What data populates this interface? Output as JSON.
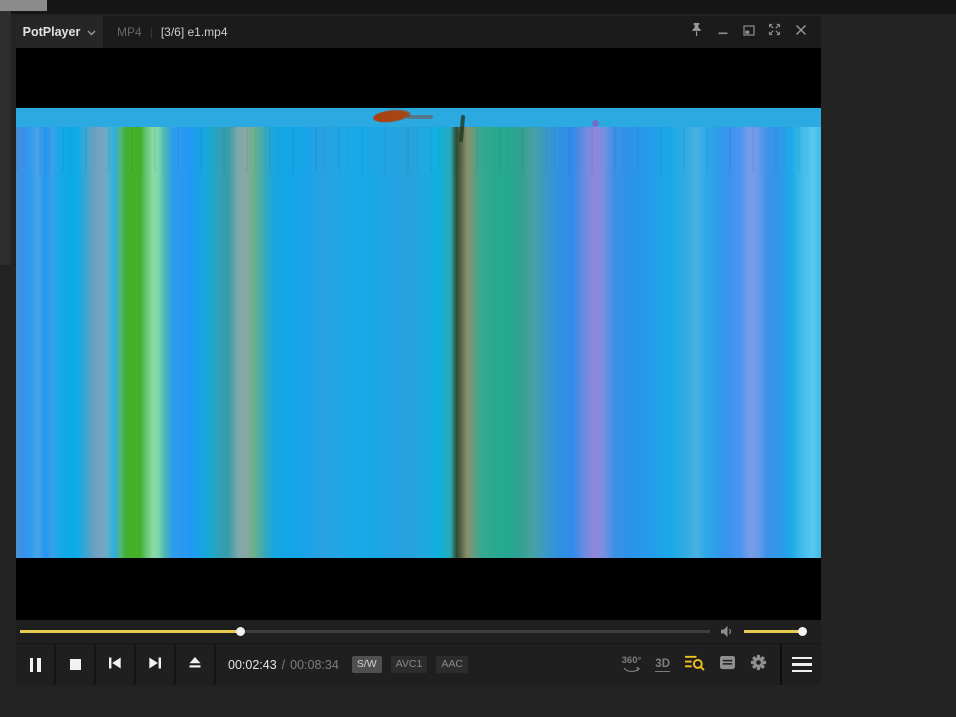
{
  "window": {
    "app_menu_label": "PotPlayer",
    "format_label": "MP4",
    "title_separator": "|",
    "file_title": "[3/6] e1.mp4"
  },
  "playback": {
    "current_time": "00:02:43",
    "time_separator": "/",
    "total_time": "00:08:34",
    "badges": [
      {
        "label": "S/W",
        "active": true
      },
      {
        "label": "AVC1",
        "active": false
      },
      {
        "label": "AAC",
        "active": false
      }
    ],
    "progress_percent": 31.9,
    "volume_percent": 94
  },
  "controls": {
    "label_360": "360°",
    "label_3d": "3D",
    "transport_icons": [
      "pause-icon",
      "stop-icon",
      "skip-previous-icon",
      "skip-next-icon",
      "eject-icon"
    ],
    "right_icons": [
      "rotation-360-icon",
      "3d-icon",
      "playlist-search-icon",
      "subtitle-doc-icon",
      "settings-gear-icon",
      "menu-hamburger-icon"
    ],
    "titlebar_icons": [
      "pin-icon",
      "minimize-icon",
      "restore-icon",
      "fullscreen-icon",
      "close-icon"
    ]
  },
  "colors": {
    "accent_yellow": "#e7cd4f",
    "icon_highlight_yellow": "#f2c41c",
    "video_top_band": "#2baae2"
  },
  "video": {
    "top_band_color": "#2baae2",
    "stripes": [
      [
        0,
        "#4796d2"
      ],
      [
        0.75,
        "#3e8ee8"
      ],
      [
        1.74,
        "#2f9bf2"
      ],
      [
        2.74,
        "#4aa4e4"
      ],
      [
        3.61,
        "#2395f2"
      ],
      [
        4.48,
        "#3aa0e8"
      ],
      [
        5.47,
        "#16a9e9"
      ],
      [
        6.72,
        "#0caae8"
      ],
      [
        7.71,
        "#12abe9"
      ],
      [
        8.96,
        "#4ba3ca"
      ],
      [
        9.83,
        "#6ba1c2"
      ],
      [
        10.7,
        "#7ba4c4"
      ],
      [
        11.44,
        "#5cb0ca"
      ],
      [
        12.31,
        "#27b1e2"
      ],
      [
        12.94,
        "#56b57a"
      ],
      [
        13.68,
        "#40ae38"
      ],
      [
        14.55,
        "#46b222"
      ],
      [
        15.42,
        "#41af2c"
      ],
      [
        16.29,
        "#6cc87e"
      ],
      [
        17.04,
        "#8cdaa2"
      ],
      [
        17.66,
        "#7ed8ac"
      ],
      [
        18.41,
        "#50b9b2"
      ],
      [
        19.4,
        "#2f9eea"
      ],
      [
        20.65,
        "#2b98f1"
      ],
      [
        21.64,
        "#2297f5"
      ],
      [
        22.64,
        "#1aa1e9"
      ],
      [
        23.88,
        "#16a9d9"
      ],
      [
        25.12,
        "#30a1b9"
      ],
      [
        26.37,
        "#389baa"
      ],
      [
        27.61,
        "#7da9aa"
      ],
      [
        28.61,
        "#8ca7a1"
      ],
      [
        29.6,
        "#69b189"
      ],
      [
        30.85,
        "#39a9b9"
      ],
      [
        32.09,
        "#16a6e1"
      ],
      [
        33.83,
        "#13a6e6"
      ],
      [
        35.95,
        "#19a3e9"
      ],
      [
        38.06,
        "#29a1e1"
      ],
      [
        40.3,
        "#21a6e6"
      ],
      [
        42.54,
        "#17a9e9"
      ],
      [
        44.78,
        "#1ca6e6"
      ],
      [
        47.01,
        "#23a3e3"
      ],
      [
        49.0,
        "#29a1d9"
      ],
      [
        50.75,
        "#1fa9e1"
      ],
      [
        52.49,
        "#10b1dd"
      ],
      [
        53.98,
        "#29a9b9"
      ],
      [
        54.73,
        "#2e4b31"
      ],
      [
        55.35,
        "#5b6949"
      ],
      [
        55.97,
        "#8b8b69"
      ],
      [
        56.72,
        "#6b9b79"
      ],
      [
        57.71,
        "#37a991"
      ],
      [
        59.2,
        "#2ba98e"
      ],
      [
        60.95,
        "#24a991"
      ],
      [
        62.56,
        "#2fa191"
      ],
      [
        64.18,
        "#49a1a1"
      ],
      [
        65.92,
        "#3999c9"
      ],
      [
        67.66,
        "#2f91e1"
      ],
      [
        69.15,
        "#308be9"
      ],
      [
        70.65,
        "#6b8be1"
      ],
      [
        71.77,
        "#9087d9"
      ],
      [
        72.89,
        "#7b8fe1"
      ],
      [
        74.38,
        "#3b91e6"
      ],
      [
        76.12,
        "#2b93e9"
      ],
      [
        77.86,
        "#2997eb"
      ],
      [
        79.6,
        "#20a1e9"
      ],
      [
        81.34,
        "#19a9e9"
      ],
      [
        83.08,
        "#31abe1"
      ],
      [
        84.45,
        "#49b1e1"
      ],
      [
        85.82,
        "#2ea9e9"
      ],
      [
        87.31,
        "#309be9"
      ],
      [
        88.56,
        "#3b91f1"
      ],
      [
        90.05,
        "#4b97f1"
      ],
      [
        91.17,
        "#7b9be9"
      ],
      [
        92.16,
        "#6b9be9"
      ],
      [
        93.28,
        "#3b93e9"
      ],
      [
        94.78,
        "#3097e9"
      ],
      [
        96.27,
        "#1ba9e9"
      ],
      [
        97.51,
        "#40b9e9"
      ],
      [
        99.0,
        "#57c9f1"
      ],
      [
        100,
        "#41b9e9"
      ]
    ]
  }
}
